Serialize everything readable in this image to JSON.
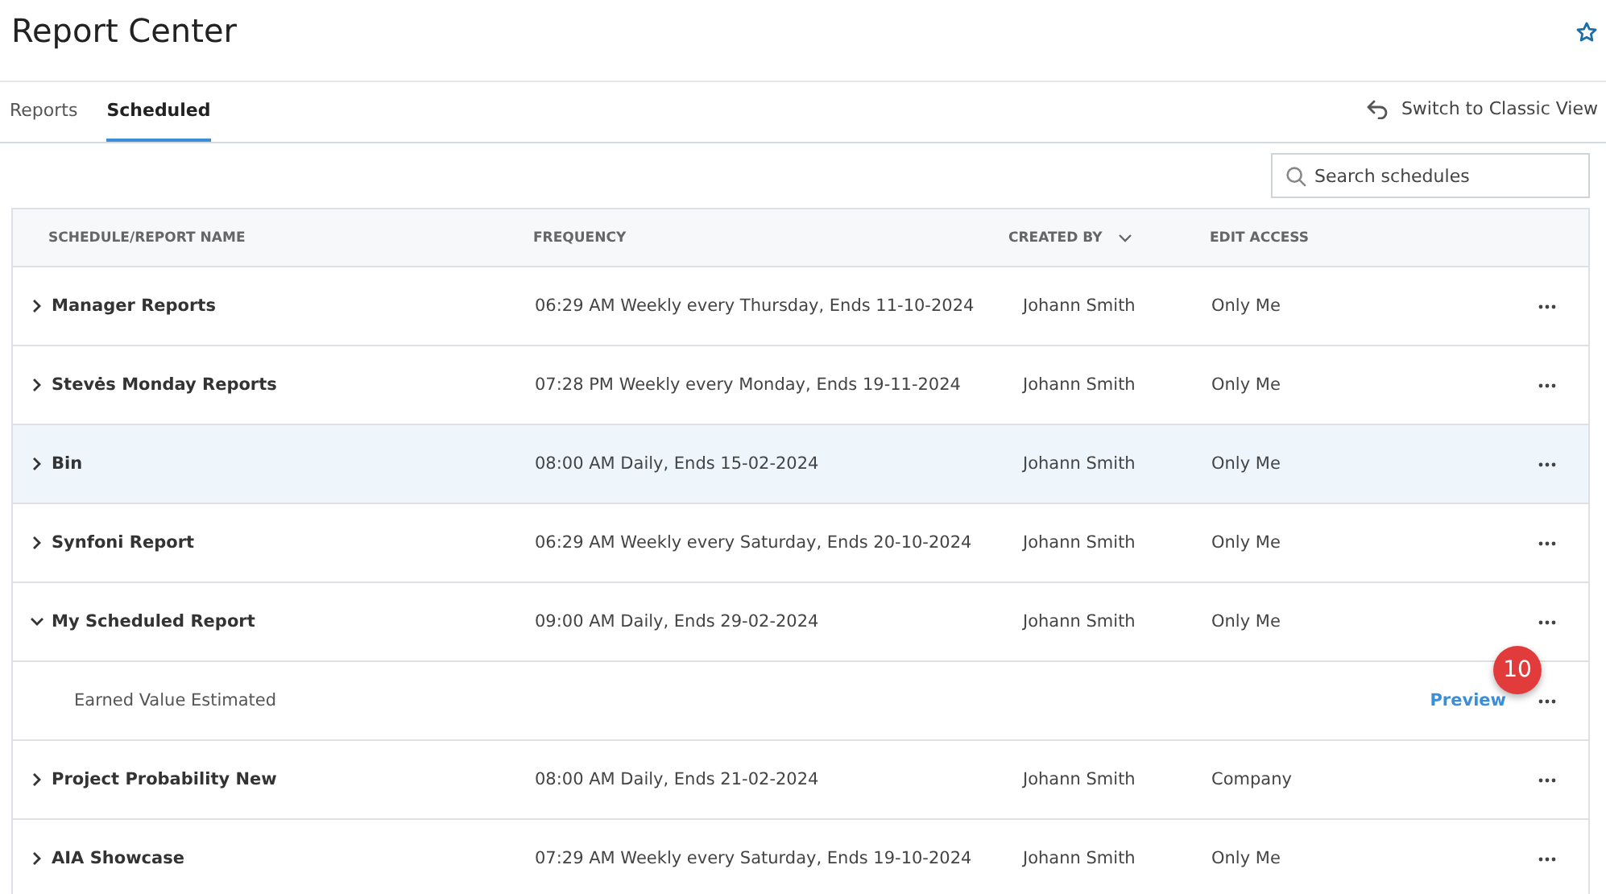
{
  "page": {
    "title": "Report Center"
  },
  "tabs": [
    {
      "label": "Reports",
      "selected": false
    },
    {
      "label": "Scheduled",
      "selected": true
    }
  ],
  "switch_link": "Switch to Classic View",
  "search": {
    "placeholder": "Search schedules"
  },
  "table": {
    "columns": [
      {
        "label": "SCHEDULE/REPORT NAME",
        "sortable": false
      },
      {
        "label": "FREQUENCY",
        "sortable": false
      },
      {
        "label": "CREATED BY",
        "sortable": true
      },
      {
        "label": "EDIT ACCESS",
        "sortable": false
      }
    ],
    "rows": [
      {
        "name": "Manager Reports",
        "frequency": "06:29 AM Weekly every Thursday, Ends 11-10-2024",
        "created_by": "Johann Smith",
        "edit_access": "Only Me",
        "expanded": false,
        "hovered": false
      },
      {
        "name": "Stevės Monday Reports",
        "frequency": "07:28 PM Weekly every Monday, Ends 19-11-2024",
        "created_by": "Johann Smith",
        "edit_access": "Only Me",
        "expanded": false,
        "hovered": false
      },
      {
        "name": "Bin",
        "frequency": "08:00 AM Daily, Ends 15-02-2024",
        "created_by": "Johann Smith",
        "edit_access": "Only Me",
        "expanded": false,
        "hovered": true
      },
      {
        "name": "Synfoni Report",
        "frequency": "06:29 AM Weekly every Saturday, Ends 20-10-2024",
        "created_by": "Johann Smith",
        "edit_access": "Only Me",
        "expanded": false,
        "hovered": false
      },
      {
        "name": "My Scheduled Report",
        "frequency": "09:00 AM Daily, Ends 29-02-2024",
        "created_by": "Johann Smith",
        "edit_access": "Only Me",
        "expanded": true,
        "hovered": false,
        "children": [
          {
            "name": "Earned Value Estimated",
            "action": "Preview",
            "badge": "10"
          }
        ]
      },
      {
        "name": "Project Probability New",
        "frequency": "08:00 AM Daily, Ends 21-02-2024",
        "created_by": "Johann Smith",
        "edit_access": "Company",
        "expanded": false,
        "hovered": false
      },
      {
        "name": "AIA Showcase",
        "frequency": "07:29 AM Weekly every Saturday, Ends 19-10-2024",
        "created_by": "Johann Smith",
        "edit_access": "Only Me",
        "expanded": false,
        "hovered": false
      }
    ]
  }
}
